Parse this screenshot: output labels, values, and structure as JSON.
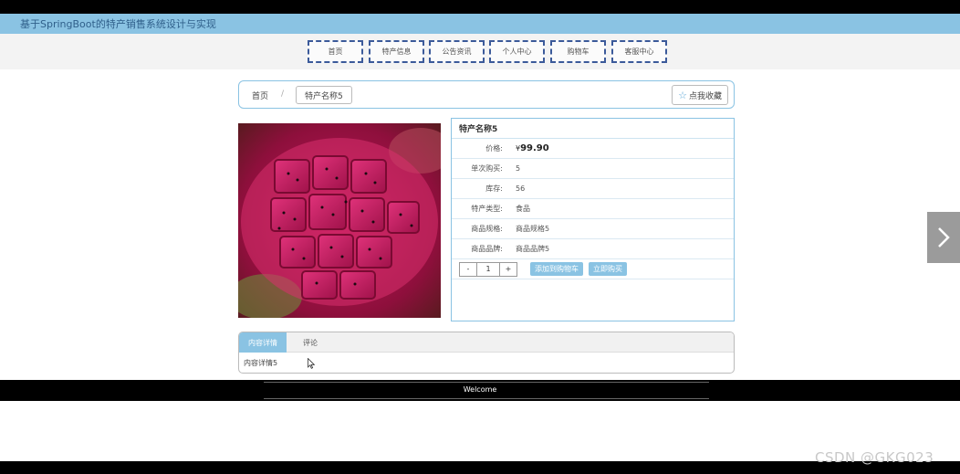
{
  "app": {
    "title": "基于SpringBoot的特产销售系统设计与实现"
  },
  "nav": {
    "items": [
      {
        "label": "首页"
      },
      {
        "label": "特产信息"
      },
      {
        "label": "公告资讯"
      },
      {
        "label": "个人中心"
      },
      {
        "label": "购物车"
      },
      {
        "label": "客服中心"
      }
    ]
  },
  "breadcrumb": {
    "home": "首页",
    "separator": "/",
    "current": "特产名称5"
  },
  "favorite": {
    "label": "点我收藏",
    "icon": "star-icon"
  },
  "product": {
    "image_alt": "dragon-fruit-image",
    "name": "特产名称5",
    "price_label": "价格:",
    "currency": "¥",
    "price": "99.90",
    "limit_label": "单次购买:",
    "limit": "5",
    "stock_label": "库存:",
    "stock": "56",
    "type_label": "特产类型:",
    "type": "食品",
    "spec_label": "商品规格:",
    "spec": "商品规格5",
    "brand_label": "商品品牌:",
    "brand": "商品品牌5"
  },
  "actions": {
    "minus": "-",
    "quantity": "1",
    "plus": "+",
    "add_to_cart": "添加到购物车",
    "buy_now": "立即购买"
  },
  "tabs": {
    "items": [
      {
        "label": "内容详情",
        "active": true
      },
      {
        "label": "评论",
        "active": false
      }
    ],
    "content": "内容详情5"
  },
  "footer": {
    "welcome": "Welcome"
  },
  "watermark": {
    "text": "CSDN @GKG023"
  },
  "colors": {
    "accent": "#8ac3e3",
    "nav_border": "#3b5a9a",
    "bar": "#000000"
  }
}
